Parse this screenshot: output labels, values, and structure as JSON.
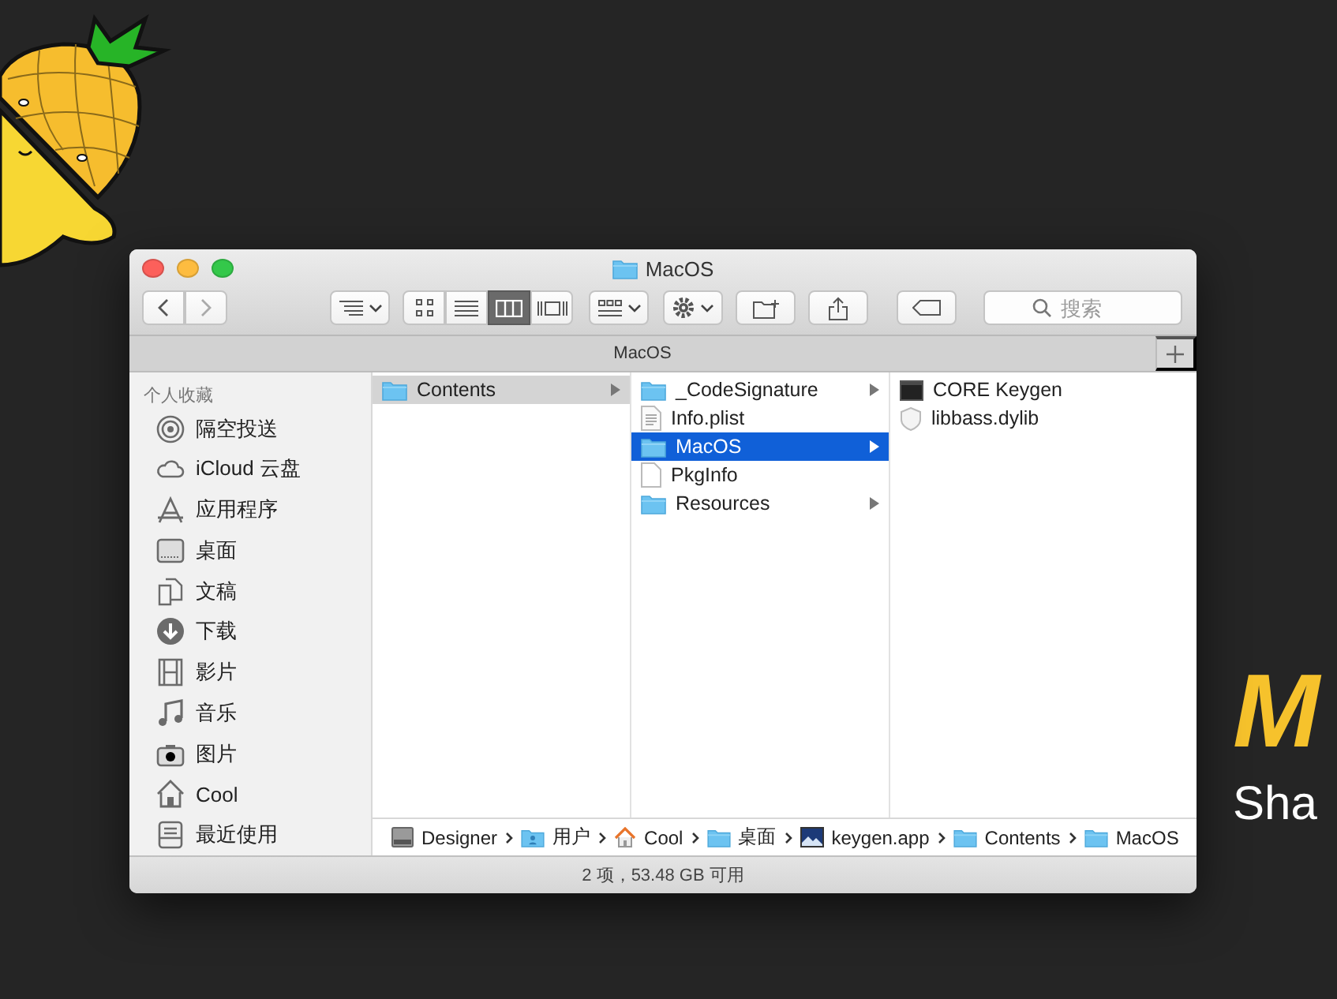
{
  "window": {
    "title": "MacOS"
  },
  "toolbar": {
    "view_modes": [
      {
        "kind": "icons",
        "selected": false
      },
      {
        "kind": "list",
        "selected": false
      },
      {
        "kind": "columns",
        "selected": true
      },
      {
        "kind": "gallery",
        "selected": false
      }
    ],
    "search": {
      "placeholder": "搜索"
    }
  },
  "tab": {
    "label": "MacOS"
  },
  "sidebar": {
    "heading": "个人收藏",
    "items": [
      {
        "label": "隔空投送",
        "kind": "airdrop"
      },
      {
        "label": "iCloud 云盘",
        "kind": "icloud"
      },
      {
        "label": "应用程序",
        "kind": "apps"
      },
      {
        "label": "桌面",
        "kind": "desktop"
      },
      {
        "label": "文稿",
        "kind": "documents"
      },
      {
        "label": "下载",
        "kind": "downloads"
      },
      {
        "label": "影片",
        "kind": "movies"
      },
      {
        "label": "音乐",
        "kind": "music"
      },
      {
        "label": "图片",
        "kind": "pictures"
      },
      {
        "label": "Cool",
        "kind": "home"
      },
      {
        "label": "最近使用",
        "kind": "recents"
      }
    ]
  },
  "columns": [
    {
      "items": [
        {
          "name": "Contents",
          "kind": "folder",
          "selected": true
        }
      ]
    },
    {
      "items": [
        {
          "name": "_CodeSignature",
          "kind": "folder",
          "selected": false
        },
        {
          "name": "Info.plist",
          "kind": "plist",
          "selected": false
        },
        {
          "name": "MacOS",
          "kind": "folder",
          "selected": true
        },
        {
          "name": "PkgInfo",
          "kind": "file",
          "selected": false
        },
        {
          "name": "Resources",
          "kind": "folder",
          "selected": false
        }
      ]
    },
    {
      "items": [
        {
          "name": "CORE Keygen",
          "kind": "app",
          "selected": false
        },
        {
          "name": "libbass.dylib",
          "kind": "dylib",
          "selected": false
        }
      ]
    }
  ],
  "path": [
    {
      "label": "Designer",
      "kind": "disk"
    },
    {
      "label": "用户",
      "kind": "users"
    },
    {
      "label": "Cool",
      "kind": "home"
    },
    {
      "label": "桌面",
      "kind": "folder"
    },
    {
      "label": "keygen.app",
      "kind": "app"
    },
    {
      "label": "Contents",
      "kind": "folder"
    },
    {
      "label": "MacOS",
      "kind": "folder"
    }
  ],
  "status": "2 项，53.48 GB 可用",
  "banner": {
    "title": "M",
    "subtitle": "Sha"
  }
}
